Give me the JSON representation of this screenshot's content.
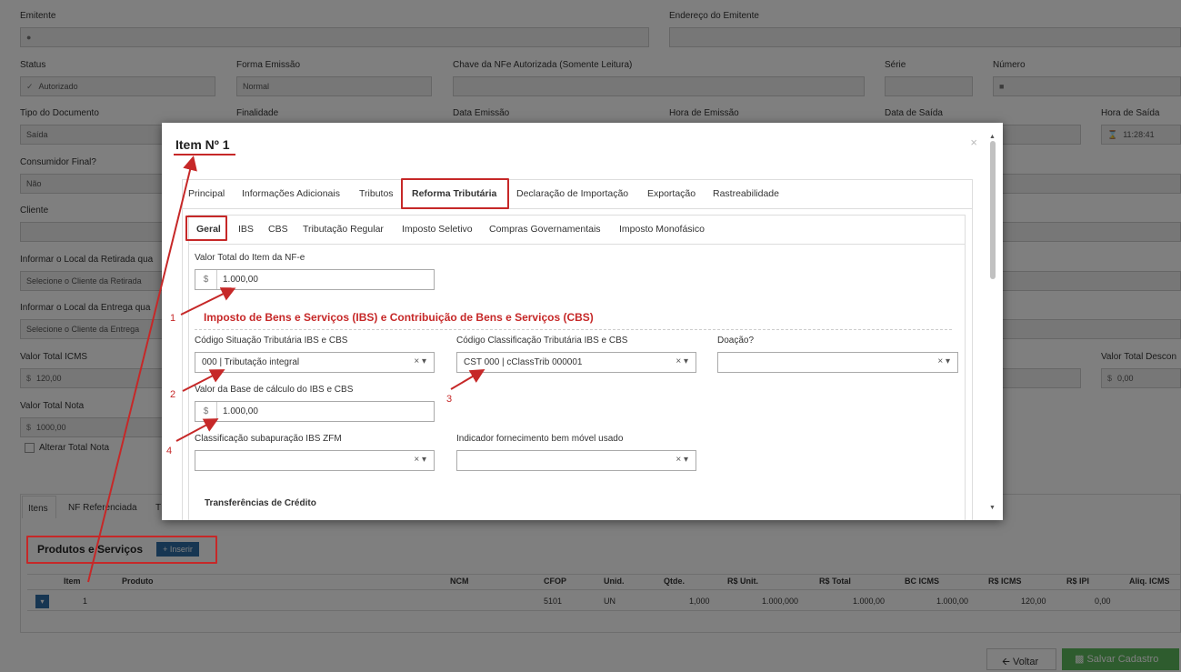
{
  "background": {
    "labels": {
      "emitente": "Emitente",
      "endereco": "Endereço do Emitente",
      "status": "Status",
      "forma_emissao": "Forma Emissão",
      "chave": "Chave da NFe Autorizada (Somente Leitura)",
      "serie": "Série",
      "numero": "Número",
      "tipo_documento": "Tipo do Documento",
      "finalidade": "Finalidade",
      "data_emissao": "Data Emissão",
      "hora_emissao": "Hora de Emissão",
      "data_saida": "Data de Saída",
      "hora_saida": "Hora de Saída",
      "consumidor_final": "Consumidor Final?",
      "cliente": "Cliente",
      "local_retirada": "Informar o Local da Retirada qua",
      "local_entrega": "Informar o Local da Entrega qua",
      "valor_total_icms": "Valor Total ICMS",
      "valor_total_desconto": "Valor Total Descon",
      "valor_total_nota": "Valor Total Nota",
      "alterar_total": "Alterar Total Nota"
    },
    "values": {
      "status": "Autorizado",
      "forma_emissao": "Normal",
      "tipo_documento": "Saída",
      "hora_saida": "11:28:41",
      "consumidor_final": "Não",
      "local_retirada": "Selecione o Cliente da Retirada",
      "local_entrega": "Selecione o Cliente da Entrega",
      "icms_prefix": "$",
      "valor_total_icms": "120,00",
      "valor_total_desconto": "0,00",
      "valor_total_nota": "1000,00"
    },
    "bottom_tabs": [
      "Itens",
      "NF Referenciada",
      "T"
    ],
    "produtos_title": "Produtos e Serviços",
    "inserir_label": "+ Inserir",
    "table": {
      "headers": [
        "Item",
        "Produto",
        "NCM",
        "CFOP",
        "Unid.",
        "Qtde.",
        "R$ Unit.",
        "R$ Total",
        "BC ICMS",
        "R$ ICMS",
        "R$ IPI",
        "Aliq. ICMS"
      ],
      "row": [
        "1",
        "",
        "",
        "5101",
        "UN",
        "1,000",
        "1.000,000",
        "1.000,00",
        "1.000,00",
        "120,00",
        "0,00",
        ""
      ]
    },
    "voltar_label": "Voltar",
    "salvar_label": "Salvar Cadastro"
  },
  "modal": {
    "title": "Item Nº 1",
    "close": "×",
    "tabs": [
      "Principal",
      "Informações Adicionais",
      "Tributos",
      "Reforma Tributária",
      "Declaração de Importação",
      "Exportação",
      "Rastreabilidade"
    ],
    "subtabs": [
      "Geral",
      "IBS",
      "CBS",
      "Tributação Regular",
      "Imposto Seletivo",
      "Compras Governamentais",
      "Imposto Monofásico"
    ],
    "valor_total_label": "Valor Total do Item da NF-e",
    "currency": "$",
    "valor_total": "1.000,00",
    "section_title": "Imposto de Bens e Serviços (IBS) e Contribuição de Bens e Serviços (CBS)",
    "cst_label": "Código Situação Tributária IBS e CBS",
    "cst_value": "000 | Tributação integral",
    "cclass_label": "Código Classificação Tributária IBS e CBS",
    "cclass_value": "CST 000 | cClassTrib 000001",
    "doacao_label": "Doação?",
    "doacao_value": "",
    "base_label": "Valor da Base de cálculo do IBS e CBS",
    "base_value": "1.000,00",
    "zfm_label": "Classificação subapuração IBS ZFM",
    "bem_movel_label": "Indicador fornecimento bem móvel usado",
    "clear_glyph": "×",
    "caret_glyph": "▾",
    "transferencias_title": "Transferências de Crédito"
  },
  "annotations": [
    "1",
    "2",
    "3",
    "4"
  ],
  "colors": {
    "highlight": "#c62828",
    "primary": "#2e6da4",
    "success": "#5cb85c"
  }
}
